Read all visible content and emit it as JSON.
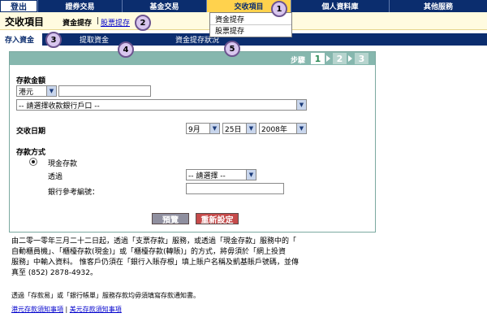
{
  "topnav": {
    "logout": "登出",
    "items": [
      "證券交易",
      "基金交易",
      "交收項目",
      "個人資料庫",
      "其他服務"
    ]
  },
  "subbar": {
    "title": "交收項目",
    "link1": "資金提存",
    "separator": "|",
    "link2": "股票提存"
  },
  "dropdown": {
    "items": [
      "資金提存",
      "股票提存"
    ]
  },
  "callouts": [
    "1",
    "2",
    "3",
    "4",
    "5"
  ],
  "tabs": {
    "active": "存入資金",
    "items": [
      "提取資金",
      "資金提存狀況"
    ]
  },
  "form": {
    "steps_label": "步驟",
    "steps": [
      "1",
      "2",
      "3"
    ],
    "amount_label": "存款金額",
    "currency": "港元",
    "amount_value": "",
    "bank_select": "-- 請選擇收款銀行戶口 --",
    "date_label": "交收日期",
    "month": "9月",
    "day": "25日",
    "year": "2008年",
    "method_label": "存款方式",
    "method_cash": "現金存款",
    "via_label": "透過",
    "via_select": "-- 請選擇 --",
    "ref_label": "銀行參考編號：",
    "ref_value": "",
    "preview_button": "預覽",
    "reset_button": "重新設定"
  },
  "notes": {
    "line1": "由二零一零年三月二十二日起，透過「支票存款」服務，或透過「現金存款」服務中的「",
    "line2": "自動櫃員機」、「櫃檯存款(現金)」或「櫃檯存款(轉賬)」的方式，將毋須於「網上投資",
    "line3": "服務」中輸入資料。 惟客戶仍須在「銀行入賬存根」填上賬户名稱及凱基賬戶號碼，並傳",
    "line4": "真至 (852) 2878-4932。",
    "line5": "透過「存款易」或「銀行帳單」服務存款均毋須填寫存款通知書。",
    "link_hkd": "港元存款須知事項",
    "sep": "|",
    "link_usd": "美元存款須知事項"
  },
  "colors": {
    "nav_bg": "#0b2d6e",
    "nav_active": "#ffd24d",
    "panel_head": "#86b7ae",
    "preview_btn": "#8f8f9f",
    "reset_btn": "#c64b4b"
  }
}
